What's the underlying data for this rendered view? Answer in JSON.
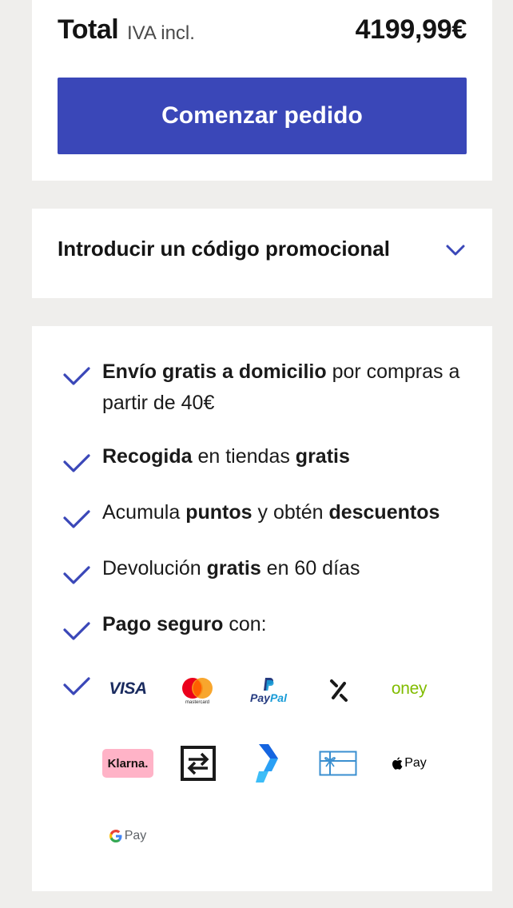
{
  "summary": {
    "total_label": "Total",
    "tax_label": "IVA incl.",
    "total_price": "4199,99€",
    "cta_label": "Comenzar pedido"
  },
  "promo": {
    "label": "Introducir un código promocional",
    "icon": "chevron-down-icon"
  },
  "benefits": [
    {
      "icon": "check-icon",
      "bold1": "Envío gratis a domicilio",
      "text1": " por compras a partir de 40€"
    },
    {
      "icon": "check-icon",
      "bold1": "Recogida",
      "text1": " en tiendas ",
      "bold2": "gratis"
    },
    {
      "icon": "check-icon",
      "text0": "Acumula ",
      "bold1": "puntos",
      "text1": " y obtén ",
      "bold2": "descuentos"
    },
    {
      "icon": "check-icon",
      "text0": "Devolución ",
      "bold1": "gratis",
      "text1": " en 60 días"
    },
    {
      "icon": "check-icon",
      "bold1": "Pago seguro",
      "text1": " con:"
    }
  ],
  "payment_methods": {
    "visa": "VISA",
    "mastercard": "mastercard",
    "paypal_1": "Pay",
    "paypal_2": "Pal",
    "oney": "oney",
    "klarna": "Klarna.",
    "applepay": "Pay",
    "gpay": "Pay"
  },
  "colors": {
    "accent": "#3a47b8",
    "background": "#efeeec",
    "card": "#ffffff"
  }
}
